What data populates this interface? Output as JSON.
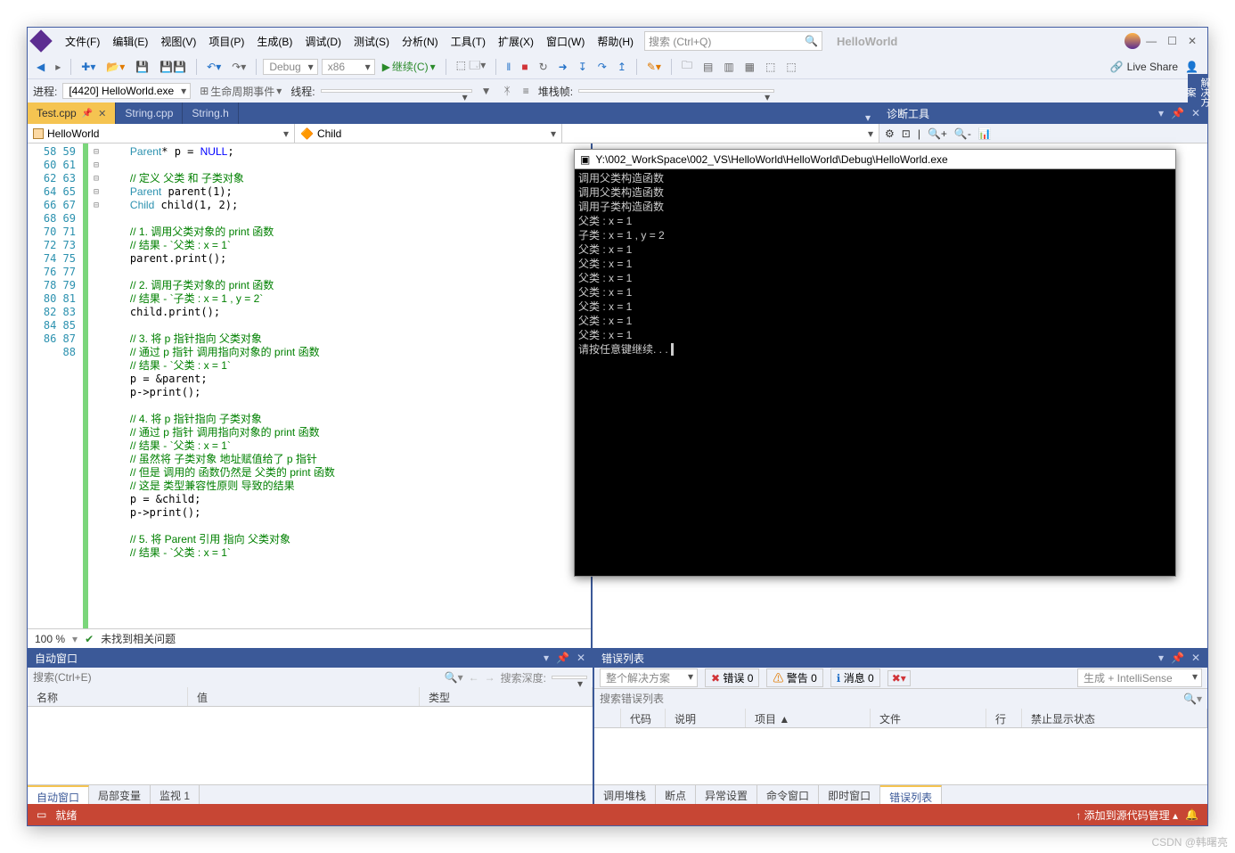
{
  "menu": {
    "file": "文件(F)",
    "edit": "编辑(E)",
    "view": "视图(V)",
    "project": "项目(P)",
    "build": "生成(B)",
    "debug": "调试(D)",
    "test": "测试(S)",
    "analyze": "分析(N)",
    "tools": "工具(T)",
    "extensions": "扩展(X)",
    "window": "窗口(W)",
    "help": "帮助(H)"
  },
  "search_placeholder": "搜索 (Ctrl+Q)",
  "app_name": "HelloWorld",
  "toolbar": {
    "config": "Debug",
    "platform": "x86",
    "continue": "继续(C)",
    "liveshare": "Live Share"
  },
  "toolbar2": {
    "process_lbl": "进程:",
    "process": "[4420] HelloWorld.exe",
    "lifecycle": "生命周期事件",
    "thread": "线程:",
    "stack": "堆栈帧:"
  },
  "tabs": [
    {
      "name": "Test.cpp",
      "active": true,
      "pinned": true
    },
    {
      "name": "String.cpp",
      "active": false
    },
    {
      "name": "String.h",
      "active": false
    }
  ],
  "diag_title": "诊断工具",
  "nav": {
    "left": "HelloWorld",
    "right": "Child"
  },
  "code_lines": [
    {
      "n": 58,
      "t": "Parent* p = NULL;"
    },
    {
      "n": 59,
      "t": ""
    },
    {
      "n": 60,
      "t": "// 定义 父类 和 子类对象"
    },
    {
      "n": 61,
      "t": "Parent parent(1);"
    },
    {
      "n": 62,
      "t": "Child child(1, 2);"
    },
    {
      "n": 63,
      "t": ""
    },
    {
      "n": 64,
      "t": "// 1. 调用父类对象的 print 函数",
      "fold": "⊟"
    },
    {
      "n": 65,
      "t": "// 结果 - `父类 : x = 1`"
    },
    {
      "n": 66,
      "t": "parent.print();"
    },
    {
      "n": 67,
      "t": ""
    },
    {
      "n": 68,
      "t": "// 2. 调用子类对象的 print 函数",
      "fold": "⊟"
    },
    {
      "n": 69,
      "t": "// 结果 - `子类 : x = 1 , y = 2`"
    },
    {
      "n": 70,
      "t": "child.print();"
    },
    {
      "n": 71,
      "t": ""
    },
    {
      "n": 72,
      "t": "// 3. 将 p 指针指向 父类对象",
      "fold": "⊟"
    },
    {
      "n": 73,
      "t": "// 通过 p 指针 调用指向对象的 print 函数"
    },
    {
      "n": 74,
      "t": "// 结果 - `父类 : x = 1`"
    },
    {
      "n": 75,
      "t": "p = &parent;"
    },
    {
      "n": 76,
      "t": "p->print();"
    },
    {
      "n": 77,
      "t": ""
    },
    {
      "n": 78,
      "t": "// 4. 将 p 指针指向 子类对象",
      "fold": "⊟"
    },
    {
      "n": 79,
      "t": "// 通过 p 指针 调用指向对象的 print 函数"
    },
    {
      "n": 80,
      "t": "// 结果 - `父类 : x = 1`"
    },
    {
      "n": 81,
      "t": "// 虽然将 子类对象 地址赋值给了 p 指针"
    },
    {
      "n": 82,
      "t": "// 但是 调用的 函数仍然是 父类的 print 函数"
    },
    {
      "n": 83,
      "t": "// 这是 类型兼容性原则 导致的结果"
    },
    {
      "n": 84,
      "t": "p = &child;"
    },
    {
      "n": 85,
      "t": "p->print();"
    },
    {
      "n": 86,
      "t": ""
    },
    {
      "n": 87,
      "t": "// 5. 将 Parent 引用 指向 父类对象",
      "fold": "⊟"
    },
    {
      "n": 88,
      "t": "// 结果 - `父类 : x = 1`"
    }
  ],
  "editor_status": {
    "zoom": "100 %",
    "issues": "未找到相关问题"
  },
  "console": {
    "title": "Y:\\002_WorkSpace\\002_VS\\HelloWorld\\HelloWorld\\Debug\\HelloWorld.exe",
    "lines": [
      "调用父类构造函数",
      "调用父类构造函数",
      "调用子类构造函数",
      "父类 : x = 1",
      "子类 : x = 1 , y = 2",
      "父类 : x = 1",
      "父类 : x = 1",
      "父类 : x = 1",
      "父类 : x = 1",
      "父类 : x = 1",
      "父类 : x = 1",
      "父类 : x = 1",
      "请按任意键继续. . . "
    ]
  },
  "autos": {
    "title": "自动窗口",
    "search_ph": "搜索(Ctrl+E)",
    "depth_lbl": "搜索深度:",
    "cols": {
      "name": "名称",
      "value": "值",
      "type": "类型"
    },
    "tabs": [
      "自动窗口",
      "局部变量",
      "监视 1"
    ]
  },
  "errors": {
    "title": "错误列表",
    "scope": "整个解决方案",
    "err": "错误 0",
    "warn": "警告 0",
    "msg": "消息 0",
    "source": "生成 + IntelliSense",
    "search_ph": "搜索错误列表",
    "cols": [
      "",
      "代码",
      "说明",
      "项目 ▲",
      "文件",
      "行",
      "禁止显示状态"
    ],
    "tabs": [
      "调用堆栈",
      "断点",
      "异常设置",
      "命令窗口",
      "即时窗口",
      "错误列表"
    ]
  },
  "statusbar": {
    "ready": "就绪",
    "scm": "添加到源代码管理"
  },
  "sidebar": "解决方案",
  "watermark": "CSDN @韩曙亮"
}
